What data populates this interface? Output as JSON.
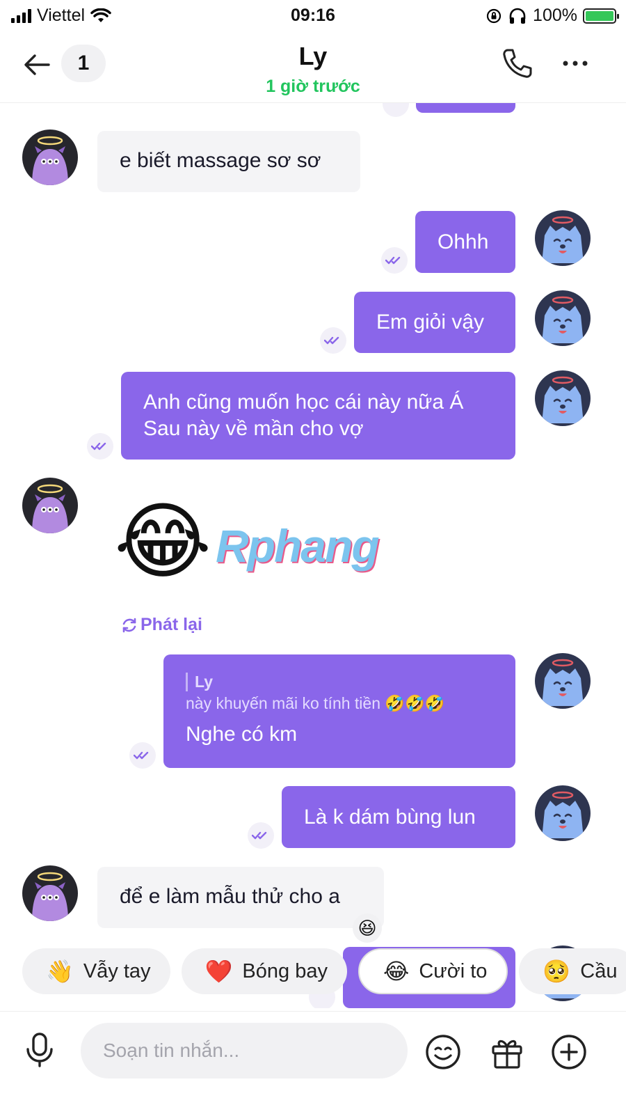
{
  "status_bar": {
    "carrier": "Viettel",
    "time": "09:16",
    "battery": "100%"
  },
  "header": {
    "unread_count": "1",
    "contact_name": "Ly",
    "last_seen": "1 giờ trước"
  },
  "messages": [
    {
      "dir": "in",
      "text": "e biết massage sơ sơ"
    },
    {
      "dir": "out",
      "text": "Ohhh"
    },
    {
      "dir": "out",
      "text": "Em giỏi vậy"
    },
    {
      "dir": "out",
      "lines": [
        "Anh cũng muốn học cái này nữa Á",
        "Sau này về mần cho vợ"
      ]
    },
    {
      "dir": "in",
      "sticker": "😂",
      "watermark": "Rphang",
      "replay_label": "Phát lại"
    },
    {
      "dir": "out",
      "reply_to": {
        "name": "Ly",
        "text": "này khuyến mãi ko tính tiền 🤣🤣🤣"
      },
      "text": "Nghe có km"
    },
    {
      "dir": "out",
      "text": "Là k dám bùng lun"
    },
    {
      "dir": "in",
      "text": "để e làm mẫu thử cho a",
      "reaction": "😆"
    }
  ],
  "quick_replies": [
    {
      "emoji": "👋",
      "label": "Vẫy tay"
    },
    {
      "emoji": "❤️",
      "label": "Bóng bay"
    },
    {
      "emoji": "😂",
      "label": "Cười to"
    },
    {
      "emoji": "🥺",
      "label": "Cầu"
    }
  ],
  "composer": {
    "placeholder": "Soạn tin nhắn..."
  },
  "colors": {
    "accent": "#8a66ea",
    "online": "#22c55e",
    "bubble_in": "#f4f4f6"
  }
}
